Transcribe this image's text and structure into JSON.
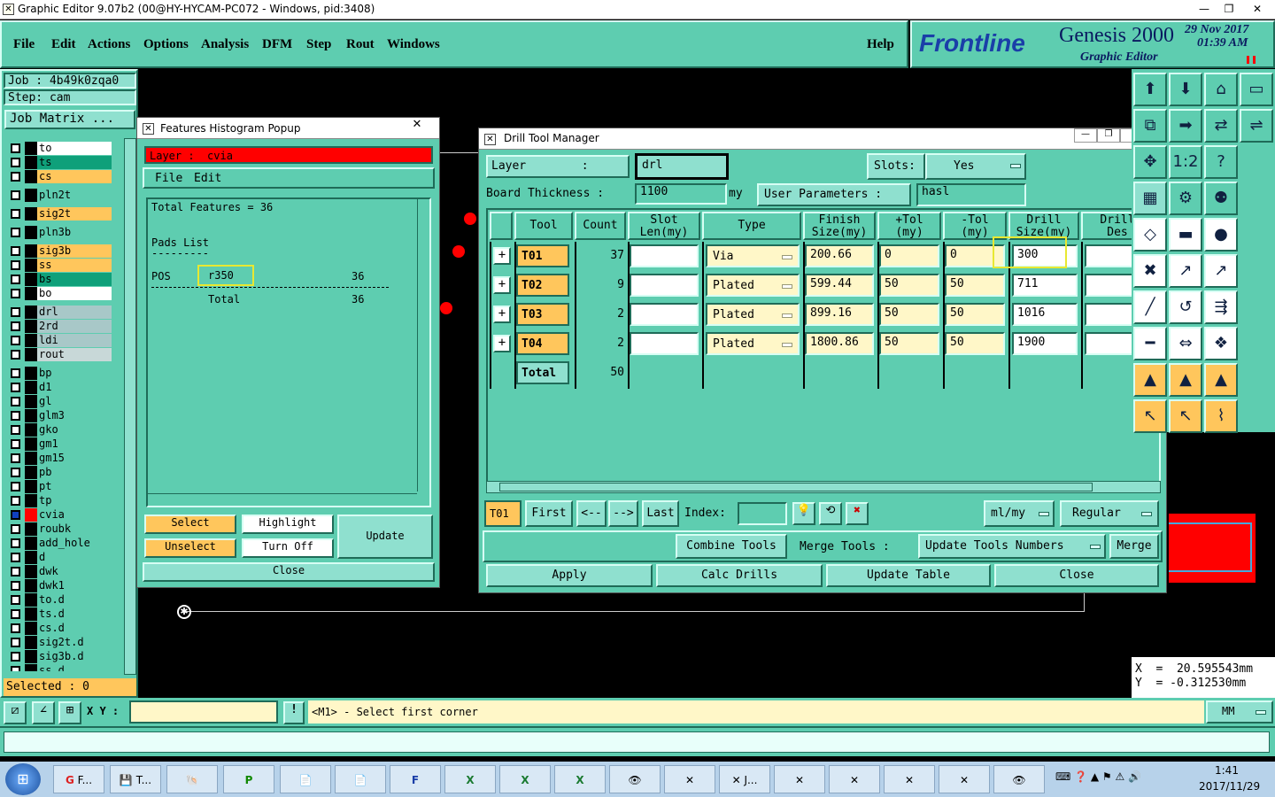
{
  "window": {
    "title": "Graphic Editor 9.07b2 (00@HY-HYCAM-PC072 - Windows, pid:3408)"
  },
  "menu": {
    "file": "File",
    "edit": "Edit",
    "actions": "Actions",
    "options": "Options",
    "analysis": "Analysis",
    "dfm": "DFM",
    "step": "Step",
    "rout": "Rout",
    "windows": "Windows",
    "help": "Help"
  },
  "brand": {
    "logo": "Frontline",
    "product": "Genesis 2000",
    "subtitle": "Graphic Editor",
    "date": "29  Nov  2017",
    "time": "01:39  AM"
  },
  "left": {
    "job": "Job : 4b49k0zqa0",
    "step": "Step: cam",
    "job_matrix": "Job Matrix ...",
    "selected": "Selected : 0",
    "layers": [
      "to",
      "ts",
      "cs",
      "pln2t",
      "sig2t",
      "pln3b",
      "sig3b",
      "ss",
      "bs",
      "bo",
      "drl",
      "2rd",
      "ldi",
      "rout",
      "bp",
      "d1",
      "gl",
      "glm3",
      "gko",
      "gm1",
      "gm15",
      "pb",
      "pt",
      "tp",
      "cvia",
      "roubk",
      "add_hole",
      "d",
      "dwk",
      "dwk1",
      "to.d",
      "ts.d",
      "cs.d",
      "sig2t.d",
      "sig3b.d",
      "ss.d"
    ]
  },
  "hist": {
    "title": "Features Histogram Popup",
    "layer_label": "Layer :",
    "layer_value": "cvia",
    "menu_file": "File",
    "menu_edit": "Edit",
    "total": "Total Features = 36",
    "pads_list": "Pads List",
    "dashes": "---------",
    "pos": "POS",
    "sym": "r350",
    "count": "36",
    "total_label": "Total",
    "total_count": "36",
    "select": "Select",
    "highlight": "Highlight",
    "unselect": "Unselect",
    "turn_off": "Turn Off",
    "update": "Update",
    "close": "Close"
  },
  "dtm": {
    "title": "Drill Tool Manager",
    "layer_label": "Layer        :",
    "layer_value": "drl",
    "slots_label": "Slots:",
    "slots_value": "Yes",
    "board_label": "Board Thickness :",
    "board_value": "1100",
    "board_unit": "my",
    "user_params_label": "User Parameters :",
    "user_params_value": "hasl",
    "headers": {
      "tool": "Tool",
      "count": "Count",
      "slot": "Slot",
      "slot2": "Len(my)",
      "type": "Type",
      "finish": "Finish",
      "finish2": "Size(my)",
      "ptol": "+Tol",
      "ptol2": "(my)",
      "ntol": "-Tol",
      "ntol2": "(my)",
      "drill": "Drill",
      "drill2": "Size(my)",
      "des": "Drill",
      "des2": "Des"
    },
    "rows": [
      {
        "tool": "T01",
        "count": "37",
        "type": "Via",
        "finish": "200.66",
        "ptol": "0",
        "ntol": "0",
        "drill": "300"
      },
      {
        "tool": "T02",
        "count": "9",
        "type": "Plated",
        "finish": "599.44",
        "ptol": "50",
        "ntol": "50",
        "drill": "711"
      },
      {
        "tool": "T03",
        "count": "2",
        "type": "Plated",
        "finish": "899.16",
        "ptol": "50",
        "ntol": "50",
        "drill": "1016"
      },
      {
        "tool": "T04",
        "count": "2",
        "type": "Plated",
        "finish": "1800.86",
        "ptol": "50",
        "ntol": "50",
        "drill": "1900"
      }
    ],
    "total_label": "Total",
    "total_count": "50",
    "nav": {
      "current": "T01",
      "first": "First",
      "prev": "<--",
      "next": "-->",
      "last": "Last",
      "index": "Index:",
      "units": "ml/my",
      "mode": "Regular"
    },
    "combine": "Combine Tools",
    "merge_label": "Merge Tools :",
    "merge_sel": "Update Tools Numbers",
    "merge": "Merge",
    "apply": "Apply",
    "calc": "Calc Drills",
    "update_table": "Update Table",
    "close": "Close"
  },
  "coords": {
    "x": "X  =  20.595543mm",
    "y": "Y  = -0.312530mm"
  },
  "status": {
    "xy_label": "X Y :",
    "prompt": "<M1> - Select first corner",
    "units": "MM"
  },
  "taskbar": {
    "clock_time": "1:41",
    "clock_date": "2017/11/29",
    "items": [
      "F...",
      "T...",
      "J..."
    ]
  },
  "colors": {
    "teal": "#5ecdb0",
    "red": "#ff0000",
    "amber": "#ffc65c",
    "highlight": "#e8e832"
  }
}
